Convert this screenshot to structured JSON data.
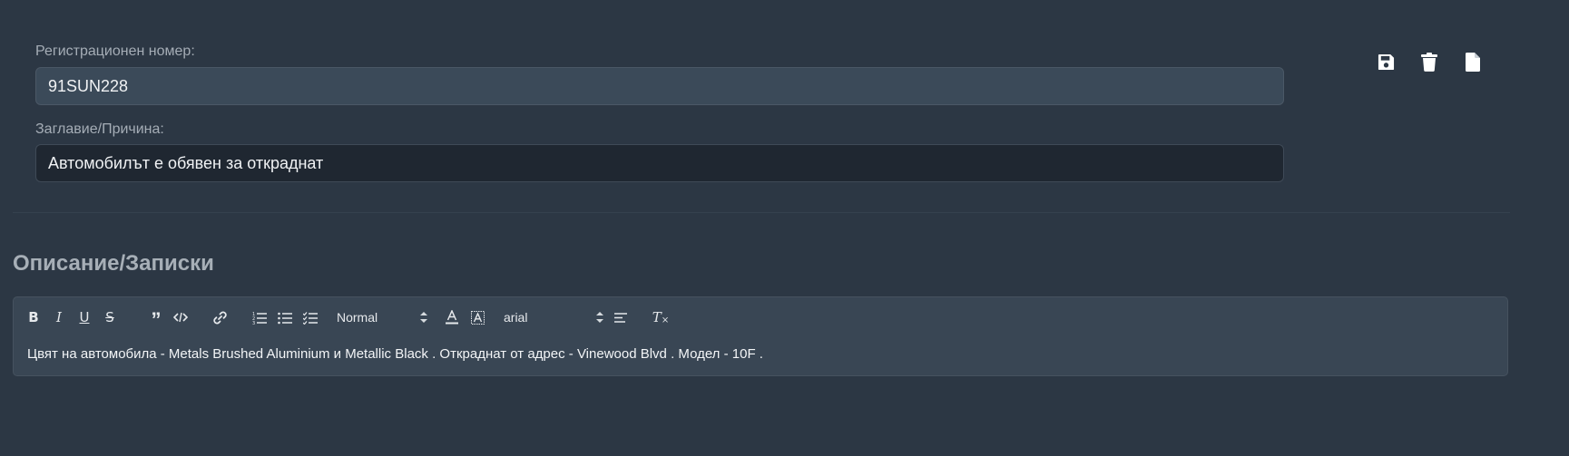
{
  "form": {
    "registration_label": "Регистрационен номер:",
    "registration_value": "91SUN228",
    "title_label": "Заглавие/Причина:",
    "title_value": "Автомобилът е обявен за откраднат"
  },
  "actions": [
    {
      "name": "save",
      "icon": "floppy-disk-icon"
    },
    {
      "name": "delete",
      "icon": "trash-icon"
    },
    {
      "name": "new-document",
      "icon": "file-icon"
    }
  ],
  "description": {
    "heading": "Описание/Записки",
    "toolbar": {
      "bold": "B",
      "italic": "I",
      "underline": "U",
      "strike": "S",
      "quote": "”",
      "size_value": "Normal",
      "font_value": "arial",
      "clean": "T"
    },
    "content": "Цвят на автомобила - Metals Brushed Aluminium и Metallic Black . Откраднат от адрес - Vinewood Blvd . Модел - 10F ."
  },
  "colors": {
    "background": "#2c3744",
    "input_active": "#3b4a59",
    "input_dark": "#1f2731",
    "editor_bg": "#394654",
    "label": "#a5adb6"
  }
}
